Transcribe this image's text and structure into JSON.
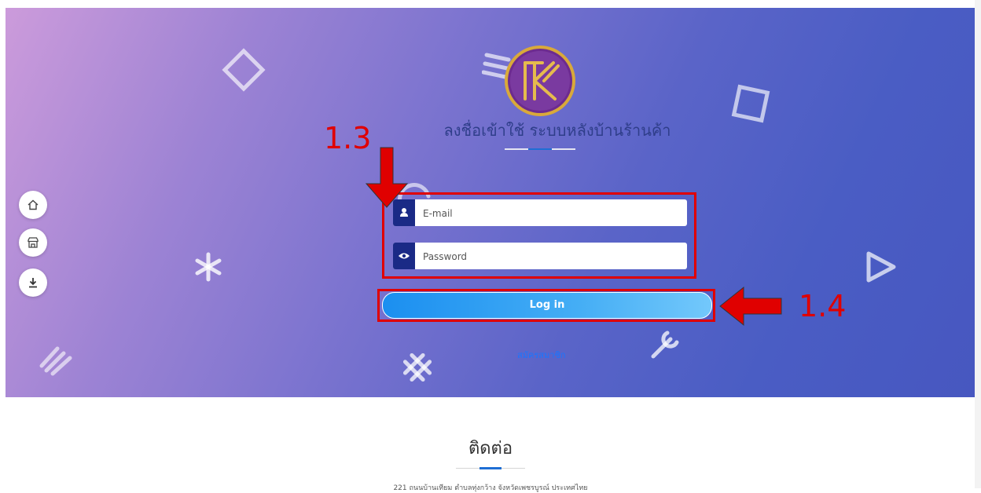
{
  "header": {
    "title": "ลงชื่อเข้าใช้ ระบบหลังบ้านร้านค้า",
    "logo_letters": "RK"
  },
  "sidebar": {
    "items": [
      {
        "icon": "home-icon"
      },
      {
        "icon": "store-icon"
      },
      {
        "icon": "download-icon"
      }
    ]
  },
  "form": {
    "email_placeholder": "E-mail",
    "email_value": "",
    "password_placeholder": "Password",
    "password_value": "",
    "login_label": "Log in",
    "register_link": "สมัครสมาชิก"
  },
  "annotations": {
    "step_inputs": "1.3",
    "step_login": "1.4"
  },
  "contact": {
    "title": "ติดต่อ",
    "address": "221 ถนนบ้านเทียม ตำบลทุ่งกว้าง จังหวัดเพชรบูรณ์ ประเทศไทย"
  },
  "colors": {
    "accent": "#1b8ff0",
    "input_icon_bg": "#1a2a86",
    "annotation_red": "#e00000",
    "title_text": "#2f3e8a"
  }
}
